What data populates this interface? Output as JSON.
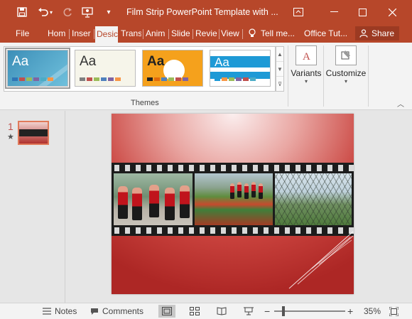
{
  "titlebar": {
    "title": "Film Strip PowerPoint Template with ...",
    "icons": [
      "save-icon",
      "undo-icon",
      "redo-icon",
      "presenter-icon",
      "customize-qat-icon",
      "ribbon-display-icon",
      "minimize-icon",
      "maximize-icon",
      "close-icon"
    ]
  },
  "tabs": [
    {
      "label": "File"
    },
    {
      "label": "Hom"
    },
    {
      "label": "Inser"
    },
    {
      "label": "Desic"
    },
    {
      "label": "Trans"
    },
    {
      "label": "Anim"
    },
    {
      "label": "Slide"
    },
    {
      "label": "Revie"
    },
    {
      "label": "View"
    },
    {
      "label": "Tell me..."
    },
    {
      "label": "Office Tut..."
    }
  ],
  "share": {
    "label": "Share"
  },
  "ribbon": {
    "themes": [
      {
        "label": "Aa",
        "bg": "#5aa6c8",
        "fg": "#ffffff",
        "swatches": [
          "#2e75b6",
          "#c0504d",
          "#9bbb59",
          "#8064a2",
          "#4bacc6",
          "#f79646"
        ]
      },
      {
        "label": "Aa",
        "bg": "#f6f5ea",
        "fg": "#333333",
        "swatches": [
          "#7f7f7f",
          "#c0504d",
          "#9bbb59",
          "#4f81bd",
          "#8064a2",
          "#f79646"
        ]
      },
      {
        "label": "Aa",
        "bg": "#f5a11c",
        "fg": "#222222",
        "swatches": [
          "#222222",
          "#e26b0a",
          "#4f81bd",
          "#9bbb59",
          "#c0504d",
          "#8064a2"
        ]
      },
      {
        "label": "Aa",
        "bg": "#1e9ad6",
        "fg": "#ffffff",
        "swatches": [
          "#1e9ad6",
          "#f79646",
          "#9bbb59",
          "#8064a2",
          "#c0504d",
          "#4bacc6"
        ]
      }
    ],
    "themes_group_label": "Themes",
    "variants_label": "Variants",
    "customize_label": "Customize"
  },
  "slides_pane": {
    "slide_number": "1"
  },
  "statusbar": {
    "notes_label": "Notes",
    "comments_label": "Comments",
    "zoom_label": "35%",
    "zoom_value": 35
  }
}
